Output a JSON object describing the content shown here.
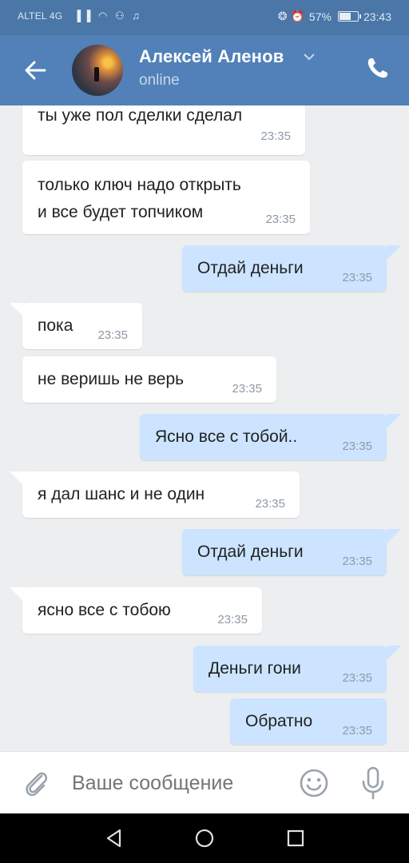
{
  "status_bar": {
    "carrier": "ALTEL 4G",
    "status_icons": "▐▐ ◠ ⚇ ♫",
    "alarm_icons": "❂ ⏰",
    "battery": "57%",
    "time": "23:43"
  },
  "header": {
    "contact_name": "Алексей Аленов",
    "presence": "online"
  },
  "messages": [
    {
      "text": "ты уже пол сделки сделал",
      "time": "23:35",
      "dir": "in"
    },
    {
      "line1": "только ключ надо открыть",
      "line2": "и все будет топчиком",
      "time": "23:35",
      "dir": "in"
    },
    {
      "text": "Отдай деньги",
      "time": "23:35",
      "dir": "out"
    },
    {
      "text": "пока",
      "time": "23:35",
      "dir": "in"
    },
    {
      "text": "не веришь не верь",
      "time": "23:35",
      "dir": "in"
    },
    {
      "text": "Ясно все с тобой..",
      "time": "23:35",
      "dir": "out"
    },
    {
      "text": "я дал шанс и не один",
      "time": "23:35",
      "dir": "in"
    },
    {
      "text": "Отдай деньги",
      "time": "23:35",
      "dir": "out"
    },
    {
      "text": "ясно все с тобою",
      "time": "23:35",
      "dir": "in"
    },
    {
      "text": "Деньги гони",
      "time": "23:35",
      "dir": "out"
    },
    {
      "text": "Обратно",
      "time": "23:35",
      "dir": "out"
    }
  ],
  "composer": {
    "placeholder": "Ваше сообщение"
  },
  "colors": {
    "header": "#5181b8",
    "status_bar": "#4a76a8",
    "incoming_bubble": "#ffffff",
    "outgoing_bubble": "#cce4ff",
    "background": "#edeef0"
  },
  "icons": [
    "back-arrow-icon",
    "chevron-down-icon",
    "phone-icon",
    "paperclip-icon",
    "emoji-icon",
    "microphone-icon",
    "nav-back-icon",
    "nav-home-icon",
    "nav-recents-icon"
  ]
}
